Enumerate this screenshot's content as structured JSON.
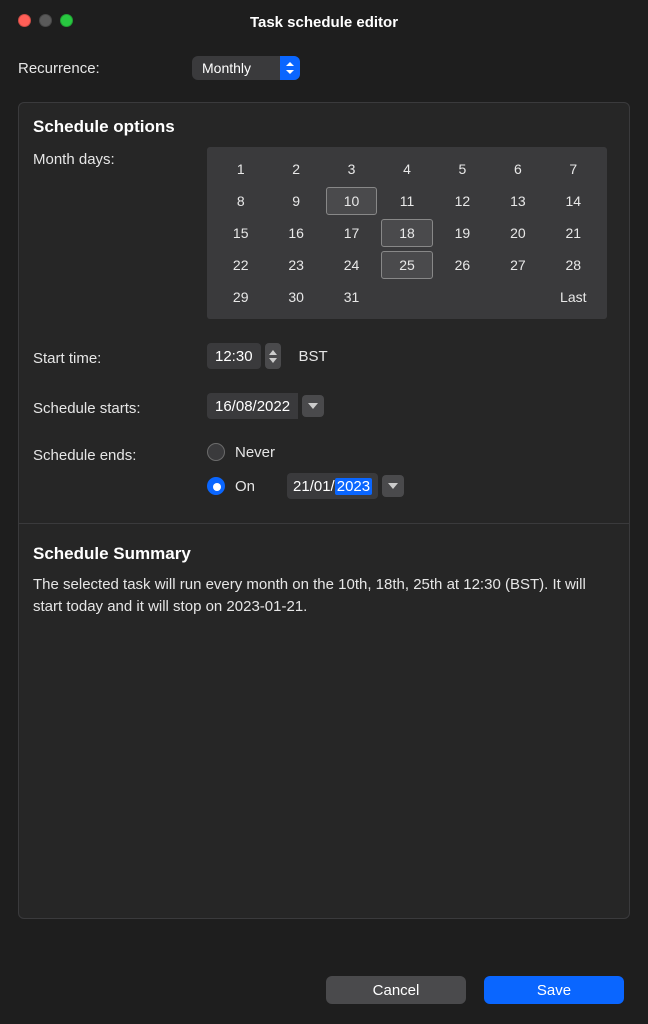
{
  "window": {
    "title": "Task schedule editor"
  },
  "recurrence": {
    "label": "Recurrence:",
    "value": "Monthly"
  },
  "schedule_options": {
    "title": "Schedule options",
    "month_days_label": "Month days:",
    "days": [
      "1",
      "2",
      "3",
      "4",
      "5",
      "6",
      "7",
      "8",
      "9",
      "10",
      "11",
      "12",
      "13",
      "14",
      "15",
      "16",
      "17",
      "18",
      "19",
      "20",
      "21",
      "22",
      "23",
      "24",
      "25",
      "26",
      "27",
      "28",
      "29",
      "30",
      "31",
      "",
      "",
      "",
      "Last"
    ],
    "selected_days": [
      "10",
      "18",
      "25"
    ],
    "start_time": {
      "label": "Start time:",
      "value": "12:30",
      "tz": "BST"
    },
    "schedule_starts": {
      "label": "Schedule starts:",
      "value": "16/08/2022"
    },
    "schedule_ends": {
      "label": "Schedule ends:",
      "never_label": "Never",
      "on_label": "On",
      "selected": "on",
      "on_date_prefix": "21/01/",
      "on_date_highlight": "2023"
    }
  },
  "summary": {
    "title": "Schedule Summary",
    "body": "The selected task will run every month on the 10th, 18th, 25th at 12:30 (BST). It will start today and it will stop on 2023-01-21."
  },
  "footer": {
    "cancel": "Cancel",
    "save": "Save"
  }
}
